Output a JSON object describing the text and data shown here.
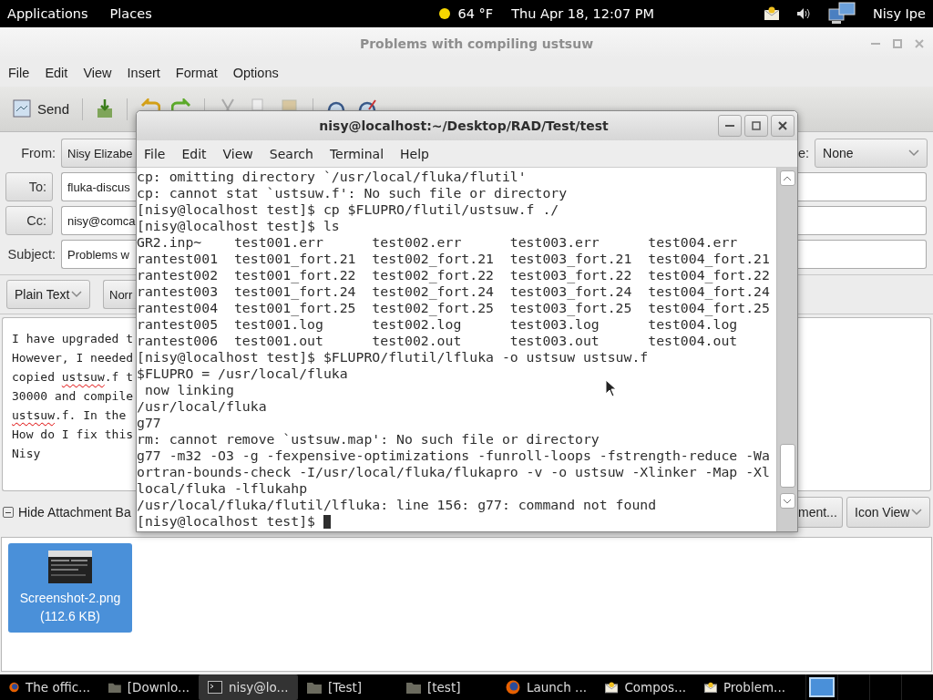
{
  "top_panel": {
    "menus": [
      "Applications",
      "Places"
    ],
    "weather": "64 °F",
    "clock": "Thu Apr 18, 12:07 PM",
    "user": "Nisy Ipe"
  },
  "composer": {
    "title": "Problems with compiling ustsuw",
    "menu": [
      "File",
      "Edit",
      "View",
      "Insert",
      "Format",
      "Options"
    ],
    "send": "Send",
    "from": {
      "label": "From:",
      "value": "Nisy Elizabe"
    },
    "signature": {
      "label": "e:",
      "value": "None"
    },
    "recipients": [
      {
        "label": "To:",
        "value": "fluka-discus"
      },
      {
        "label": "Cc:",
        "value": "nisy@comca"
      }
    ],
    "subject": {
      "label": "Subject:",
      "value": "Problems w"
    },
    "format": {
      "mode": "Plain Text",
      "paragraph": "Norr"
    },
    "body": [
      [
        {
          "text": "I have upgraded t",
          "misspelled": false
        }
      ],
      [
        {
          "text": "However, I needed",
          "misspelled": false
        }
      ],
      [
        {
          "text": "copied ",
          "misspelled": false
        },
        {
          "text": "ustsuw",
          "misspelled": true
        },
        {
          "text": ".f t",
          "misspelled": false
        }
      ],
      [
        {
          "text": "30000 and compile",
          "misspelled": false
        }
      ],
      [
        {
          "text": "ustsuw",
          "misspelled": true
        },
        {
          "text": ".f. In the",
          "misspelled": false
        }
      ],
      [
        {
          "text": "How do I fix this",
          "misspelled": false
        }
      ],
      [
        {
          "text": "Nisy",
          "misspelled": false
        }
      ]
    ],
    "attachment_bar": {
      "label": "Hide Attachment Ba",
      "expanded": true,
      "add_button": "ment...",
      "view": "Icon View"
    },
    "attachments": [
      {
        "name": "Screenshot-2.png",
        "size": "(112.6 KB)",
        "selected": true
      }
    ]
  },
  "terminal": {
    "title": "nisy@localhost:~/Desktop/RAD/Test/test",
    "menu": [
      "File",
      "Edit",
      "View",
      "Search",
      "Terminal",
      "Help"
    ],
    "lines": [
      "cp: omitting directory `/usr/local/fluka/flutil'",
      "cp: cannot stat `ustsuw.f': No such file or directory",
      "[nisy@localhost test]$ cp $FLUPRO/flutil/ustsuw.f ./",
      "[nisy@localhost test]$ ls",
      "GR2.inp~    test001.err      test002.err      test003.err      test004.err",
      "rantest001  test001_fort.21  test002_fort.21  test003_fort.21  test004_fort.21",
      "rantest002  test001_fort.22  test002_fort.22  test003_fort.22  test004_fort.22",
      "rantest003  test001_fort.24  test002_fort.24  test003_fort.24  test004_fort.24",
      "rantest004  test001_fort.25  test002_fort.25  test003_fort.25  test004_fort.25",
      "rantest005  test001.log      test002.log      test003.log      test004.log",
      "rantest006  test001.out      test002.out      test003.out      test004.out",
      "[nisy@localhost test]$ $FLUPRO/flutil/lfluka -o ustsuw ustsuw.f",
      "$FLUPRO = /usr/local/fluka",
      " now linking",
      "/usr/local/fluka",
      "g77",
      "rm: cannot remove `ustsuw.map': No such file or directory",
      "g77 -m32 -O3 -g -fexpensive-optimizations -funroll-loops -fstrength-reduce -Wa",
      "ortran-bounds-check -I/usr/local/fluka/flukapro -v -o ustsuw -Xlinker -Map -Xl",
      "local/fluka -lflukahp",
      "/usr/local/fluka/flutil/lfluka: line 156: g77: command not found"
    ],
    "prompt": "[nisy@localhost test]$"
  },
  "taskbar": {
    "items": [
      {
        "label": "The offic...",
        "kind": "browser",
        "selected": false
      },
      {
        "label": "[Downlo...",
        "kind": "folder",
        "selected": false
      },
      {
        "label": "nisy@lo...",
        "kind": "terminal",
        "selected": true
      },
      {
        "label": "[Test]",
        "kind": "folder",
        "selected": false
      },
      {
        "label": "[test]",
        "kind": "folder",
        "selected": false
      },
      {
        "label": "Launch ...",
        "kind": "browser",
        "selected": false
      },
      {
        "label": "Compos...",
        "kind": "mail",
        "selected": false
      },
      {
        "label": "Problem...",
        "kind": "mail",
        "selected": false
      }
    ],
    "workspaces": [
      {
        "selected": true
      },
      {
        "selected": false
      },
      {
        "selected": false
      },
      {
        "selected": false
      }
    ]
  }
}
